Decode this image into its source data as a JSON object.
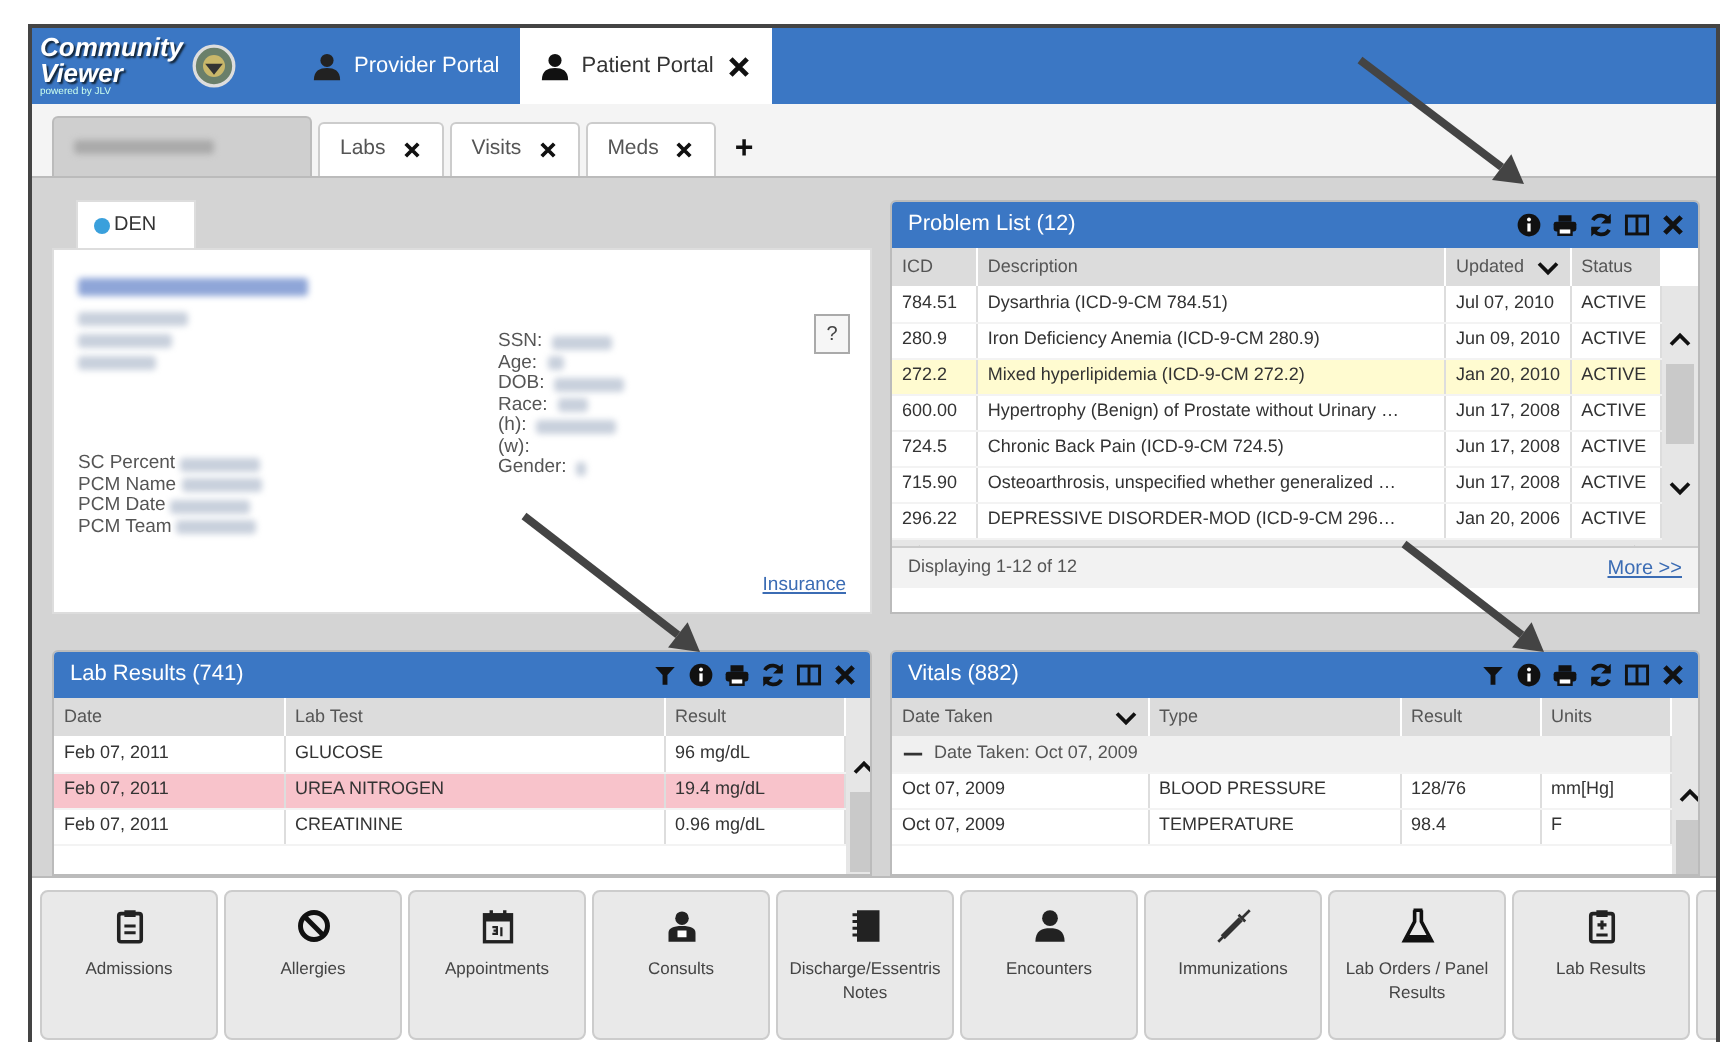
{
  "top_bar": {
    "logo": [
      "Community",
      "Viewer"
    ],
    "logo_subtitle": "powered by JLV",
    "portal_tabs": [
      {
        "label": "Provider Portal",
        "selected": false
      },
      {
        "label": "Patient Portal",
        "selected": true
      }
    ]
  },
  "patient_tabs": [
    {
      "kind": "patient",
      "selected": true
    },
    {
      "kind": "tab",
      "label": "Labs",
      "selected": false
    },
    {
      "kind": "tab",
      "label": "Visits",
      "selected": false
    },
    {
      "kind": "tab",
      "label": "Meds",
      "selected": false
    },
    {
      "kind": "add",
      "label": "+"
    }
  ],
  "patient_card": {
    "site_tab": {
      "label": "DEN",
      "color": "#3aa0dc"
    },
    "help": "?",
    "left_labels": [
      "SC Percent",
      "PCM Name",
      "PCM Date",
      "PCM Team"
    ],
    "right_labels": [
      "SSN:",
      "Age:",
      "DOB:",
      "Race:",
      "(h):",
      "(w):",
      "Gender:"
    ],
    "link": "Insurance"
  },
  "problem_list": {
    "title": "Problem List (12)",
    "columns": [
      {
        "label": "ICD",
        "sorted": false
      },
      {
        "label": "Description",
        "sorted": false
      },
      {
        "label": "Updated",
        "sorted": true
      },
      {
        "label": "Status",
        "sorted": false
      }
    ],
    "rows": [
      {
        "cells": [
          "784.51",
          "Dysarthria (ICD-9-CM 784.51)",
          "Jul 07, 2010",
          "ACTIVE"
        ],
        "selected": false
      },
      {
        "cells": [
          "280.9",
          "Iron Deficiency Anemia (ICD-9-CM 280.9)",
          "Jun 09, 2010",
          "ACTIVE"
        ],
        "selected": false
      },
      {
        "cells": [
          "272.2",
          "Mixed hyperlipidemia (ICD-9-CM 272.2)",
          "Jan 20, 2010",
          "ACTIVE"
        ],
        "selected": true
      },
      {
        "cells": [
          "600.00",
          "Hypertrophy (Benign) of Prostate without Urinary …",
          "Jun 17, 2008",
          "ACTIVE"
        ],
        "selected": false
      },
      {
        "cells": [
          "724.5",
          "Chronic Back Pain (ICD-9-CM 724.5)",
          "Jun 17, 2008",
          "ACTIVE"
        ],
        "selected": false
      },
      {
        "cells": [
          "715.90",
          "Osteoarthrosis, unspecified whether generalized …",
          "Jun 17, 2008",
          "ACTIVE"
        ],
        "selected": false
      },
      {
        "cells": [
          "296.22",
          "DEPRESSIVE DISORDER-MOD (ICD-9-CM 296…",
          "Jan 20, 2006",
          "ACTIVE"
        ],
        "selected": false
      }
    ],
    "footer": "Displaying 1-12 of 12",
    "more": "More >>"
  },
  "lab_results": {
    "title": "Lab Results (741)",
    "columns": [
      {
        "label": "Date",
        "sorted": false
      },
      {
        "label": "Lab Test",
        "sorted": false
      },
      {
        "label": "Result",
        "sorted": false
      }
    ],
    "rows": [
      {
        "cells": [
          "Feb 07, 2011",
          "GLUCOSE",
          "96 mg/dL"
        ],
        "abnormal": false
      },
      {
        "cells": [
          "Feb 07, 2011",
          "UREA NITROGEN",
          "19.4 mg/dL"
        ],
        "abnormal": true
      },
      {
        "cells": [
          "Feb 07, 2011",
          "CREATININE",
          "0.96 mg/dL"
        ],
        "abnormal": false
      }
    ]
  },
  "vitals": {
    "title": "Vitals (882)",
    "columns": [
      {
        "label": "Date Taken",
        "sorted": true
      },
      {
        "label": "Type",
        "sorted": false
      },
      {
        "label": "Result",
        "sorted": false
      },
      {
        "label": "Units",
        "sorted": false
      }
    ],
    "group": "Date Taken:  Oct 07, 2009",
    "rows": [
      {
        "cells": [
          "Oct 07, 2009",
          "BLOOD PRESSURE",
          "128/76",
          "mm[Hg]"
        ]
      },
      {
        "cells": [
          "Oct 07, 2009",
          "TEMPERATURE",
          "98.4",
          "F"
        ]
      }
    ]
  },
  "toolbar": [
    {
      "label": "Admissions"
    },
    {
      "label": "Allergies"
    },
    {
      "label": "Appointments"
    },
    {
      "label": "Consults"
    },
    {
      "label": "Discharge/Essentris Notes"
    },
    {
      "label": "Encounters"
    },
    {
      "label": "Immunizations"
    },
    {
      "label": "Lab Orders / Panel Results"
    },
    {
      "label": "Lab Results"
    }
  ]
}
